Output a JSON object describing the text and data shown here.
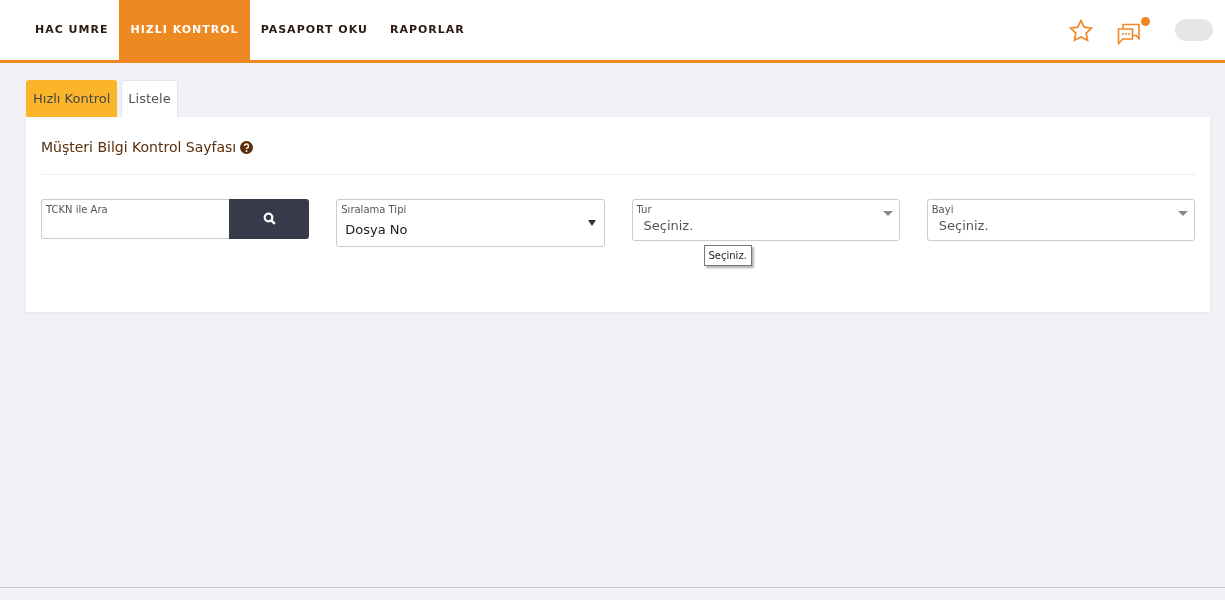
{
  "nav": {
    "items": [
      {
        "label": "HAC UMRE",
        "selected": false
      },
      {
        "label": "HIZLI KONTROL",
        "selected": true
      },
      {
        "label": "PASAPORT OKU",
        "selected": false
      },
      {
        "label": "RAPORLAR",
        "selected": false
      }
    ],
    "has_notification": true
  },
  "tabs": [
    {
      "label": "Hızlı Kontrol",
      "selected": true
    },
    {
      "label": "Listele",
      "selected": false
    }
  ],
  "page_title": "Müşteri Bilgi Kontrol Sayfası",
  "fields": [
    {
      "kind": "search",
      "label": "TCKN ile Ara"
    },
    {
      "kind": "select",
      "label": "Sıralama Tipi",
      "value": "Dosya No"
    },
    {
      "kind": "select2",
      "label": "Tur",
      "value": "Seçiniz.",
      "tooltip": "Seçiniz."
    },
    {
      "kind": "select2",
      "label": "Bayi",
      "value": "Seçiniz."
    }
  ]
}
